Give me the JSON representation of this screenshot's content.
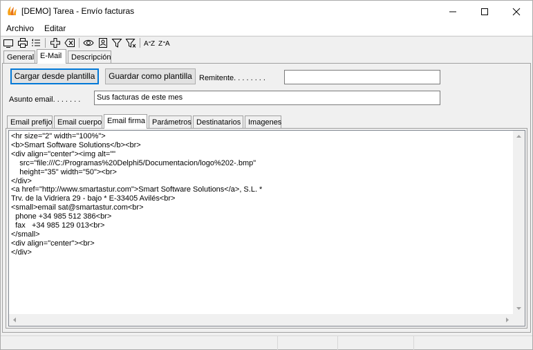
{
  "window": {
    "title": "[DEMO] Tarea - Envío facturas",
    "accent": "#ff8c00"
  },
  "menu": [
    "Archivo",
    "Editar"
  ],
  "toolbar_icons": [
    "window-icon",
    "print-icon",
    "list-icon",
    "add-icon",
    "delete-icon",
    "view-icon",
    "user-card-icon",
    "filter-icon",
    "clear-filter-icon",
    "sort-asc-icon",
    "sort-desc-icon"
  ],
  "tabs": [
    "General",
    "E-Mail",
    "Descripción"
  ],
  "email": {
    "load_template": "Cargar desde plantilla",
    "save_template": "Guardar como plantilla",
    "sender_label": "Remitente. . . . . . . .",
    "sender_value": "",
    "subject_label": "Asunto email. . . . . . .",
    "subject_value": "Sus facturas de este mes"
  },
  "subtabs": [
    "Email prefijo",
    "Email cuerpo",
    "Email firma",
    "Parámetros",
    "Destinatarios",
    "Imagenes"
  ],
  "signature_html": "<hr size=\"2\" width=\"100%\">\n<b>Smart Software Solutions</b><br>\n<div align=\"center\"><img alt=\"\"\n    src=\"file:///C:/Programas%20Delphi5/Documentacion/logo%202-.bmp\"\n    height=\"35\" width=\"50\"><br>\n</div>\n<a href=\"http://www.smartastur.com\">Smart Software Solutions</a>, S.L. *\nTrv. de la Vidriera 29 - bajo * E-33405 Avilés<br>\n<small>email sat@smartastur.com<br>\n  phone +34 985 512 386<br>\n  fax   +34 985 129 013<br>\n</small>\n<div align=\"center\"><br>\n</div>"
}
